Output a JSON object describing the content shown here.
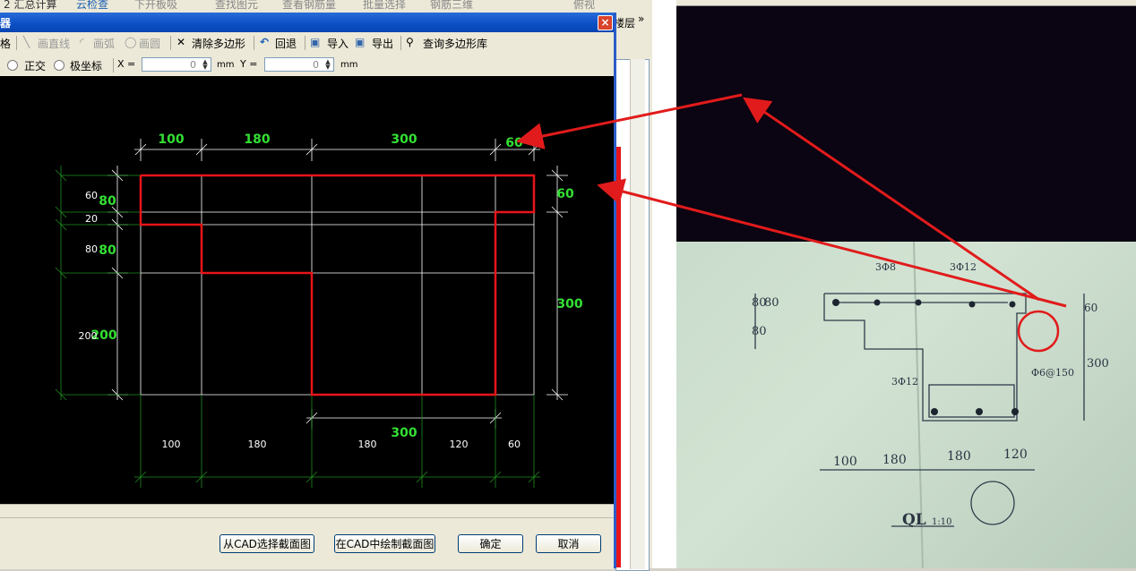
{
  "topstrip": {
    "items": [
      "2 汇总计算",
      "云检查",
      "下开板吸",
      "查找图元",
      "查看钢筋量",
      "批量选择",
      "钢筋三维",
      "俯视"
    ],
    "right_label": "楼层",
    "chevron": "»"
  },
  "dialog": {
    "title": "器",
    "close_label": "×",
    "toolbar": {
      "grid": "格",
      "draw_line": "画直线",
      "draw_arc": "画弧",
      "draw_circle": "画圆",
      "clear_polygon": "清除多边形",
      "undo": "回退",
      "import": "导入",
      "export": "导出",
      "query_library": "查询多边形库"
    },
    "coords": {
      "ortho": "正交",
      "polar": "极坐标",
      "x_label": "X =",
      "x_value": "0",
      "x_unit": "mm",
      "y_label": "Y =",
      "y_value": "0",
      "y_unit": "mm"
    },
    "buttons": {
      "from_cad": "从CAD选择截面图",
      "draw_in_cad": "在CAD中绘制截面图",
      "ok": "确定",
      "cancel": "取消"
    }
  },
  "drawing": {
    "top_dims": [
      "100",
      "180",
      "300",
      "60"
    ],
    "bottom_dims": [
      "100",
      "180",
      "180",
      "120",
      "60"
    ],
    "bottom_mid_dim": "300",
    "left_white": [
      "60",
      "20",
      "80",
      "200"
    ],
    "left_green": [
      "80",
      "80",
      "200"
    ],
    "right_dims": [
      "60",
      "300"
    ]
  },
  "photo": {
    "labels": [
      "3Φ8",
      "3Φ12",
      "3Φ12",
      "Φ6@150",
      "80",
      "80",
      "80",
      "60",
      "300",
      "100",
      "180",
      "180",
      "120",
      "QL",
      "1:10"
    ]
  },
  "colors": {
    "accent_green": "#33e033",
    "section_red": "#e8141a",
    "arrow_red": "#e11b1b",
    "title_blue": "#0a4ec4"
  }
}
